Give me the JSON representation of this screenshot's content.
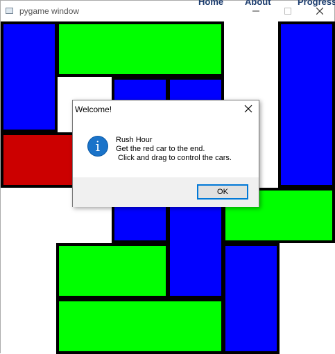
{
  "window": {
    "title": "pygame window",
    "peek_tabs": [
      "Home",
      "About",
      "Progress"
    ]
  },
  "colors": {
    "blue": "#0000ff",
    "green": "#00ff00",
    "red": "#cc0000",
    "border": "#000000",
    "dialog_accent": "#0078d7"
  },
  "icons": {
    "app": "pygame-app-icon",
    "info": "info-icon",
    "minimize": "minimize-icon",
    "maximize": "maximize-icon",
    "close": "close-icon"
  },
  "dialog": {
    "title": "Welcome!",
    "line1": "Rush Hour",
    "line2": "Get the red car to the end.",
    "line3": " Click and drag to control the cars.",
    "ok_label": "OK"
  }
}
